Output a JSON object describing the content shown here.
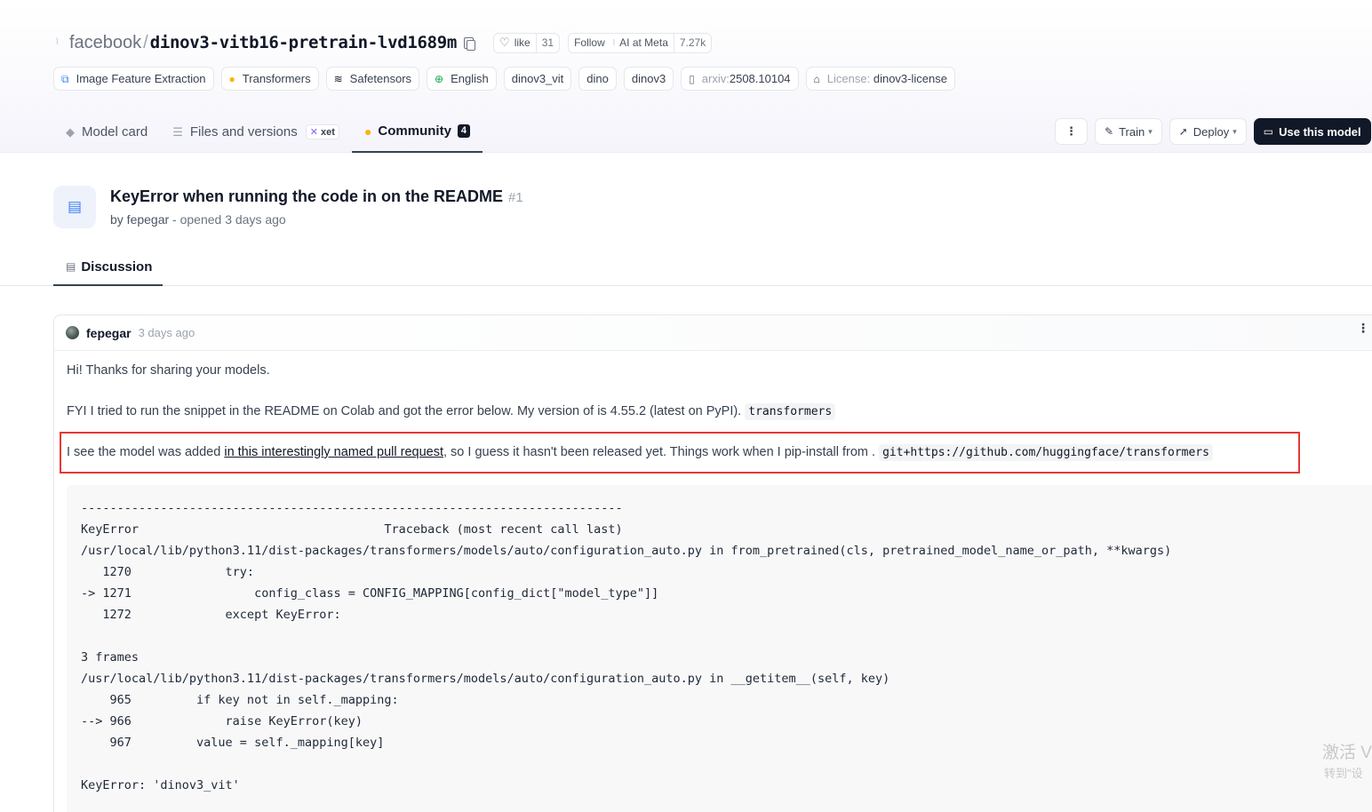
{
  "repo": {
    "org": "facebook",
    "name": "dinov3-vitb16-pretrain-lvd1689m",
    "like_label": "like",
    "like_count": "31",
    "follow_label": "Follow",
    "follow_org": "AI at Meta",
    "follow_count": "7.27k"
  },
  "tags": [
    {
      "label": "Image Feature Extraction",
      "icon": "image-feature-icon"
    },
    {
      "label": "Transformers",
      "icon": "hugging-face-icon"
    },
    {
      "label": "Safetensors",
      "icon": "safetensors-icon"
    },
    {
      "label": "English",
      "icon": "globe-icon"
    },
    {
      "label": "dinov3_vit"
    },
    {
      "label": "dino"
    },
    {
      "label": "dinov3"
    },
    {
      "label_prefix": "arxiv:",
      "label": "2508.10104",
      "icon": "paper-icon"
    },
    {
      "label_prefix": "License:",
      "label": "dinov3-license",
      "icon": "bank-icon"
    }
  ],
  "nav": {
    "model_card": "Model card",
    "files": "Files and versions",
    "xet": "xet",
    "community": "Community",
    "community_count": "4"
  },
  "actions": {
    "train": "Train",
    "deploy": "Deploy",
    "use": "Use this model"
  },
  "discussion": {
    "title": "KeyError when running the code in on the README",
    "number": "#1",
    "by": "by fepegar",
    "opened": " - opened 3 days ago",
    "tab": "Discussion"
  },
  "comment": {
    "author": "fepegar",
    "ago": "3 days ago",
    "p1": "Hi! Thanks for sharing your models.",
    "p2_text": "FYI I tried to run the snippet in the README on Colab and got the error below. My version of is 4.55.2 (latest on PyPI).",
    "p2_code": "transformers",
    "p3_pre": "I see the model was added ",
    "p3_link": "in this interestingly named pull request",
    "p3_mid": ", so I guess it hasn't been released yet. Things work when I pip-install from .",
    "p3_code": "git+https://github.com/huggingface/transformers",
    "code": "---------------------------------------------------------------------------\nKeyError                                  Traceback (most recent call last)\n/usr/local/lib/python3.11/dist-packages/transformers/models/auto/configuration_auto.py in from_pretrained(cls, pretrained_model_name_or_path, **kwargs)\n   1270             try:\n-> 1271                 config_class = CONFIG_MAPPING[config_dict[\"model_type\"]]\n   1272             except KeyError:\n\n3 frames\n/usr/local/lib/python3.11/dist-packages/transformers/models/auto/configuration_auto.py in __getitem__(self, key)\n    965         if key not in self._mapping:\n--> 966             raise KeyError(key)\n    967         value = self._mapping[key]\n\nKeyError: 'dinov3_vit'"
  },
  "watermark": {
    "line1": "激活 V",
    "line2": "转到\"设"
  },
  "colors": {
    "accent_dark": "#111827",
    "highlight_border": "#e53935",
    "discussion_icon": "#3b82f6"
  }
}
